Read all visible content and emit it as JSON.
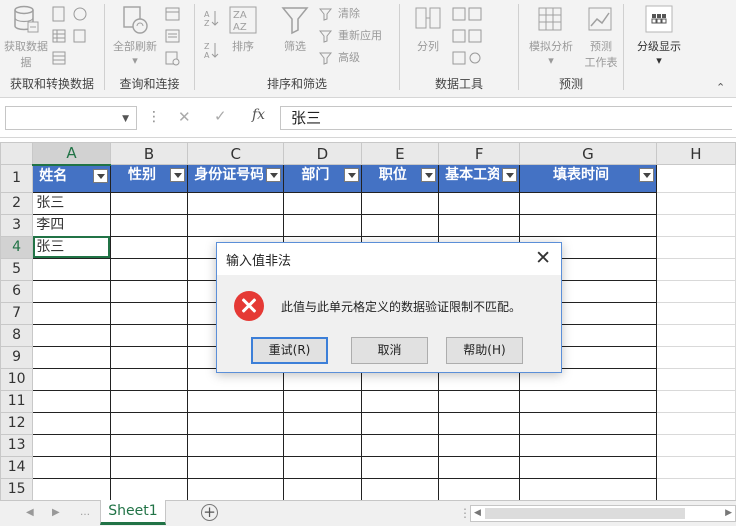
{
  "ribbon": {
    "groups": [
      {
        "label": "获取和转换数据",
        "buttons": [
          {
            "label": "获取数据",
            "sub": "据"
          }
        ]
      },
      {
        "label": "查询和连接",
        "buttons": [
          {
            "label": "全部刷新"
          }
        ]
      },
      {
        "label": "排序和筛选",
        "buttons": [
          {
            "label": "排序"
          },
          {
            "label": "筛选"
          },
          {
            "label": "清除"
          },
          {
            "label": "重新应用"
          },
          {
            "label": "高级"
          }
        ]
      },
      {
        "label": "数据工具",
        "buttons": [
          {
            "label": "分列"
          }
        ]
      },
      {
        "label": "预测",
        "buttons": [
          {
            "label": "模拟分析"
          },
          {
            "label": "预测",
            "sub": "工作表"
          }
        ]
      },
      {
        "label": "",
        "buttons": [
          {
            "label": "分级显示"
          }
        ]
      }
    ]
  },
  "formula_bar": {
    "name_box": "",
    "fx": "fx",
    "value": "张三"
  },
  "grid": {
    "columns": [
      "A",
      "B",
      "C",
      "D",
      "E",
      "F",
      "G",
      "H"
    ],
    "rows": [
      "1",
      "2",
      "3",
      "4",
      "5",
      "6",
      "7",
      "8",
      "9",
      "10",
      "11",
      "12",
      "13",
      "14",
      "15"
    ],
    "headers": [
      "姓名",
      "性别",
      "身份证号码",
      "部门",
      "职位",
      "基本工资",
      "填表时间"
    ],
    "cells": {
      "A2": "张三",
      "A3": "李四",
      "A4": "张三"
    },
    "active_cell": "A4"
  },
  "tabs": {
    "sheets": [
      "Sheet1"
    ],
    "active": "Sheet1",
    "add": "+"
  },
  "dialog": {
    "title": "输入值非法",
    "message": "此值与此单元格定义的数据验证限制不匹配。",
    "buttons": {
      "retry": "重试(R)",
      "cancel": "取消",
      "help": "帮助(H)"
    },
    "close": "✕"
  },
  "colors": {
    "header_fill": "#4472c4",
    "accent": "#217346",
    "error": "#e53935"
  }
}
